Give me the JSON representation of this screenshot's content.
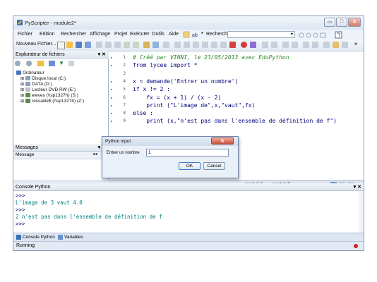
{
  "window": {
    "title": "PyScripter - module2*"
  },
  "menu": [
    "Fichier",
    "Edition",
    "Rechercher",
    "Affichage",
    "Projet",
    "Exécuter",
    "Outils",
    "Aide"
  ],
  "search": {
    "label": "Rechercher"
  },
  "toolbar": {
    "new_file": "Nouveau Fichier...",
    "more": "»"
  },
  "explorer": {
    "title": "Explorateur de fichiers",
    "items": [
      {
        "label": "Ordinateur",
        "level": 0
      },
      {
        "label": "Disque local (C:)",
        "level": 1
      },
      {
        "label": "DATA (D:)",
        "level": 1
      },
      {
        "label": "Lecteur DVD RW (E:)",
        "level": 1
      },
      {
        "label": "eleves (\\\\sp1327h) (S:)",
        "level": 1
      },
      {
        "label": "ressaille$ (\\\\sp1327h) (Z:)",
        "level": 1
      }
    ]
  },
  "messages": {
    "title": "Messages",
    "column": "Message"
  },
  "editor": {
    "lines": [
      {
        "n": "1",
        "text": "# Créé par VINNI, le 23/05/2013 avec EduPython",
        "color": "#2a8a2a",
        "italic": true
      },
      {
        "n": "2",
        "text": "from lycee import *",
        "color": "#000080",
        "italic": false
      },
      {
        "n": "3",
        "text": "",
        "color": "#000000",
        "italic": false
      },
      {
        "n": "4",
        "text": "x = demande('Entrer un nombre')",
        "color": "#000080",
        "italic": false
      },
      {
        "n": "5",
        "text": "if x != 2 :",
        "color": "#000080",
        "italic": false
      },
      {
        "n": "6",
        "text": "    fx = (x + 1) / (x - 2)",
        "color": "#000080",
        "italic": false
      },
      {
        "n": "7",
        "text": "    print (\"L'image de\",x,\"vaut\",fx)",
        "color": "#000080",
        "italic": false
      },
      {
        "n": "8",
        "text": "else :",
        "color": "#000080",
        "italic": false
      },
      {
        "n": "9",
        "text": "    print (x,\"n'est pas dans l'ensemble de définition de f\")",
        "color": "#000080",
        "italic": false
      }
    ],
    "tabs": [
      "module2",
      "module3"
    ]
  },
  "dialog": {
    "title": "Python input",
    "prompt": "Entrer un nombre",
    "value": "1",
    "ok": "OK",
    "cancel": "Cancel"
  },
  "console": {
    "title": "Console Python",
    "lines": [
      {
        "text": ">>>",
        "color": "#000080"
      },
      {
        "text": "L'image de 3 vaut 4.0",
        "color": "#008080"
      },
      {
        "text": ">>>",
        "color": "#000080"
      },
      {
        "text": "2 n'est pas dans l'ensemble de définition de f",
        "color": "#008080"
      },
      {
        "text": ">>>",
        "color": "#000080"
      }
    ],
    "tabs": [
      "Console Python",
      "Variables"
    ]
  },
  "status": {
    "text": "Running"
  }
}
